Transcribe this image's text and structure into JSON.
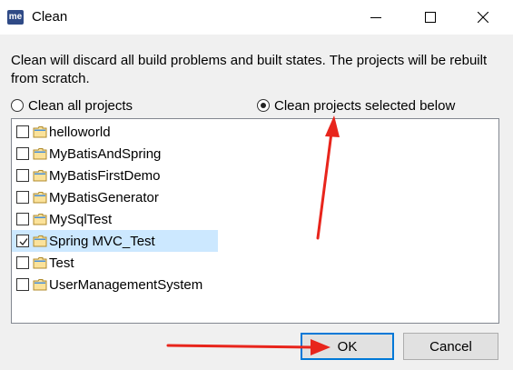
{
  "window": {
    "icon_text": "me",
    "title": "Clean"
  },
  "description": "Clean will discard all build problems and built states.  The projects will be rebuilt from scratch.",
  "options": {
    "clean_all": {
      "label": "Clean all projects",
      "checked": false
    },
    "clean_selected": {
      "label": "Clean projects selected below",
      "checked": true
    }
  },
  "projects": [
    {
      "name": "helloworld",
      "checked": false
    },
    {
      "name": "MyBatisAndSpring",
      "checked": false
    },
    {
      "name": "MyBatisFirstDemo",
      "checked": false
    },
    {
      "name": "MyBatisGenerator",
      "checked": false
    },
    {
      "name": "MySqlTest",
      "checked": false
    },
    {
      "name": "Spring MVC_Test",
      "checked": true,
      "highlighted": true
    },
    {
      "name": "Test",
      "checked": false
    },
    {
      "name": "UserManagementSystem",
      "checked": false
    }
  ],
  "buttons": {
    "ok": "OK",
    "cancel": "Cancel"
  },
  "colors": {
    "annotation_arrow": "#e8251c",
    "default_button_border": "#0078d7",
    "selected_row": "#cce8ff"
  }
}
